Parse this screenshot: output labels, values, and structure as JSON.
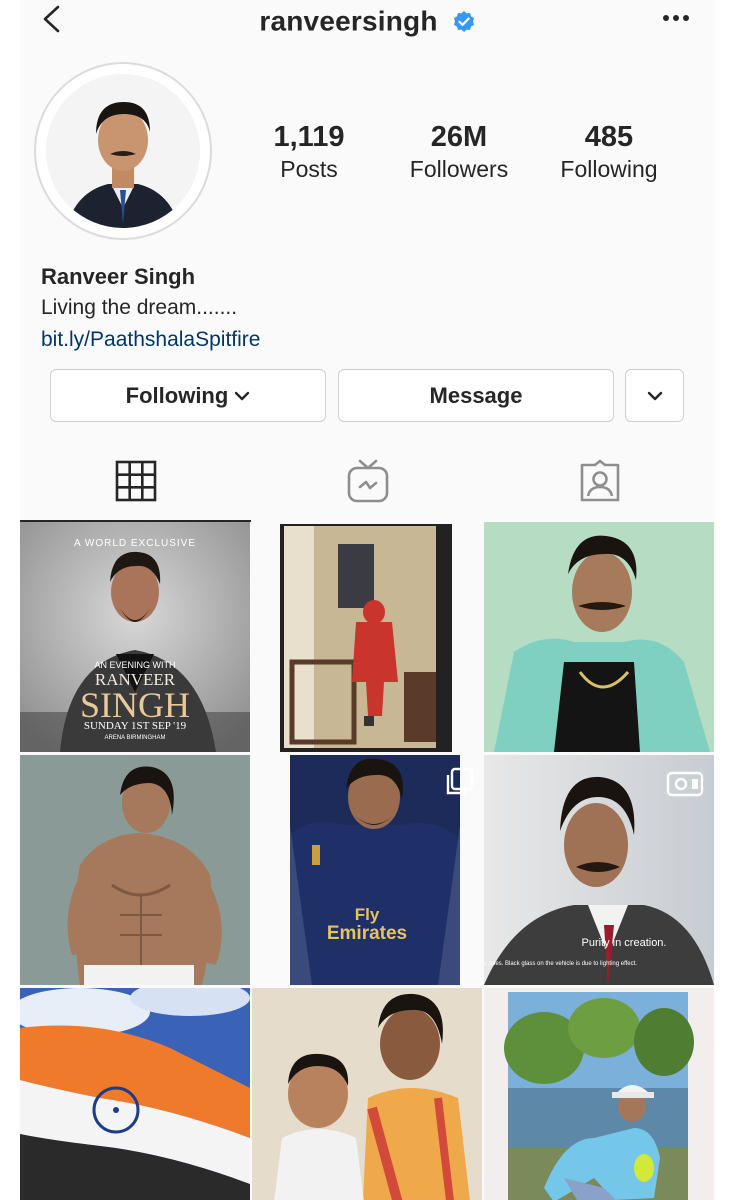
{
  "header": {
    "username": "ranveersingh",
    "back_icon": "chevron-left-icon",
    "verified_icon": "verified-badge-icon",
    "more_icon": "more-horizontal-icon"
  },
  "profile": {
    "stats": [
      {
        "value": "1,119",
        "label": "Posts"
      },
      {
        "value": "26M",
        "label": "Followers"
      },
      {
        "value": "485",
        "label": "Following"
      }
    ],
    "display_name": "Ranveer Singh",
    "bio": "Living the dream.......",
    "link": "bit.ly/PaathshalaSpitfire"
  },
  "actions": {
    "following_label": "Following",
    "message_label": "Message"
  },
  "tabs": [
    {
      "icon": "grid-icon",
      "active": true
    },
    {
      "icon": "igtv-icon",
      "active": false
    },
    {
      "icon": "tagged-icon",
      "active": false
    }
  ],
  "posts": {
    "post1": {
      "overlay_top": "A WORLD EXCLUSIVE",
      "overlay_sub": "AN EVENING WITH",
      "overlay_name1": "RANVEER",
      "overlay_name2": "SINGH",
      "overlay_date": "SUNDAY 1ST SEP '19",
      "overlay_venue": "ARENA BIRMINGHAM"
    },
    "post5": {
      "jersey_text1": "Fly",
      "jersey_text2": "Emirates",
      "badge_icon": "carousel-icon"
    },
    "post6": {
      "caption": "Purity in creation.",
      "small_text": "c rules. Black glass on the vehicle is due to lighting effect.",
      "badge_icon": "video-icon"
    }
  },
  "colors": {
    "link": "#003569",
    "verified": "#3897f0",
    "text": "#262626"
  }
}
